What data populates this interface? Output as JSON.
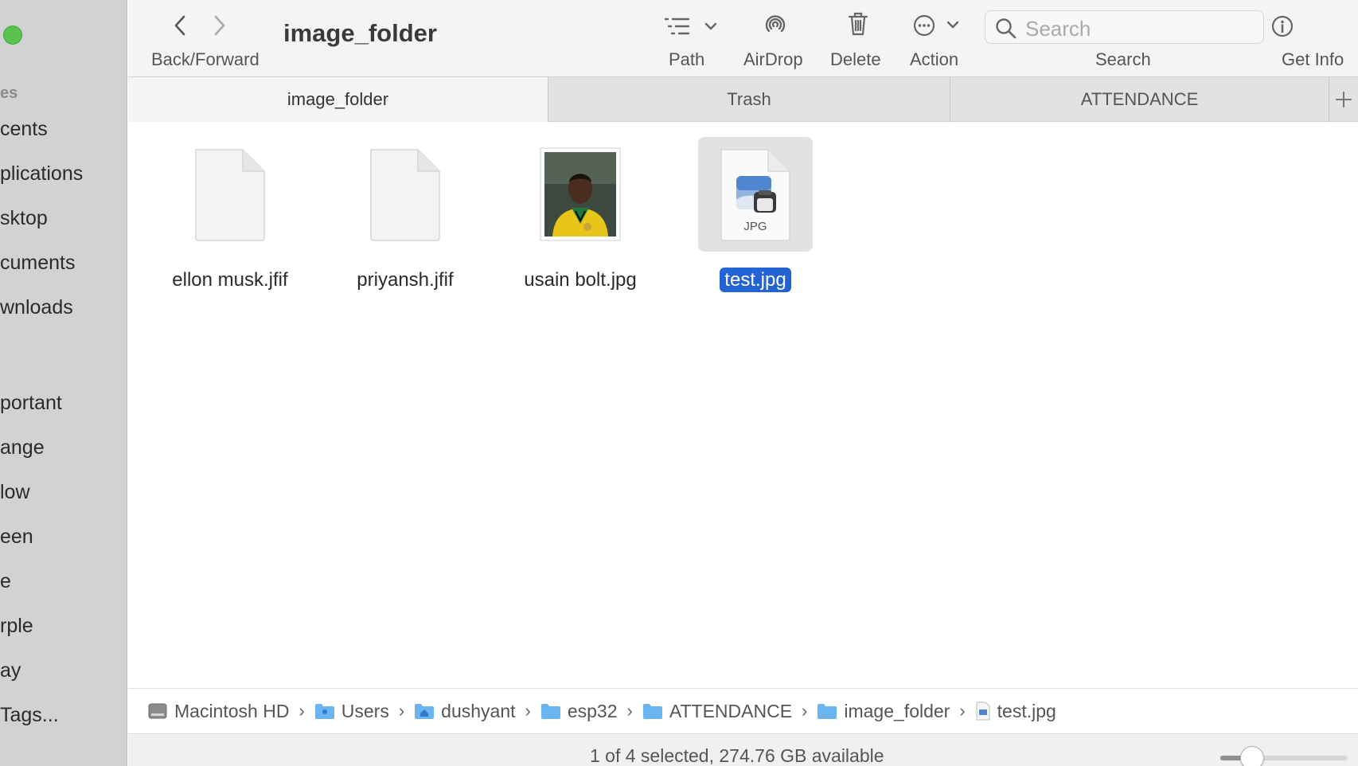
{
  "window": {
    "title": "image_folder"
  },
  "sidebar": {
    "section_label": "es",
    "items": [
      {
        "label": "cents"
      },
      {
        "label": "plications"
      },
      {
        "label": "sktop"
      },
      {
        "label": "cuments"
      },
      {
        "label": "wnloads"
      },
      {
        "label": "portant"
      },
      {
        "label": "ange"
      },
      {
        "label": "low"
      },
      {
        "label": "een"
      },
      {
        "label": "e"
      },
      {
        "label": "rple"
      },
      {
        "label": "ay"
      },
      {
        "label": "Tags..."
      }
    ]
  },
  "toolbar": {
    "back_forward_label": "Back/Forward",
    "path_label": "Path",
    "airdrop_label": "AirDrop",
    "delete_label": "Delete",
    "action_label": "Action",
    "search_label": "Search",
    "search_placeholder": "Search",
    "get_info_label": "Get Info"
  },
  "tabs": [
    {
      "label": "image_folder",
      "active": true
    },
    {
      "label": "Trash",
      "active": false
    },
    {
      "label": "ATTENDANCE",
      "active": false
    }
  ],
  "files": [
    {
      "name": "ellon musk.jfif",
      "kind": "blank-document",
      "selected": false
    },
    {
      "name": "priyansh.jfif",
      "kind": "blank-document",
      "selected": false
    },
    {
      "name": "usain bolt.jpg",
      "kind": "photo-thumbnail",
      "selected": false
    },
    {
      "name": "test.jpg",
      "kind": "jpg-document",
      "badge": "JPG",
      "selected": true
    }
  ],
  "path": [
    {
      "label": "Macintosh HD",
      "icon": "hard-drive-icon"
    },
    {
      "label": "Users",
      "icon": "folder-icon"
    },
    {
      "label": "dushyant",
      "icon": "home-folder-icon"
    },
    {
      "label": "esp32",
      "icon": "folder-icon"
    },
    {
      "label": "ATTENDANCE",
      "icon": "folder-icon"
    },
    {
      "label": "image_folder",
      "icon": "folder-icon"
    },
    {
      "label": "test.jpg",
      "icon": "jpg-file-icon"
    }
  ],
  "status": {
    "text": "1 of 4 selected, 274.76 GB available"
  },
  "icon_size_slider": {
    "value": 0.25
  },
  "colors": {
    "selection": "#2463d3",
    "sidebar": "#d2d2d2",
    "traffic_green": "#5ac24e"
  }
}
